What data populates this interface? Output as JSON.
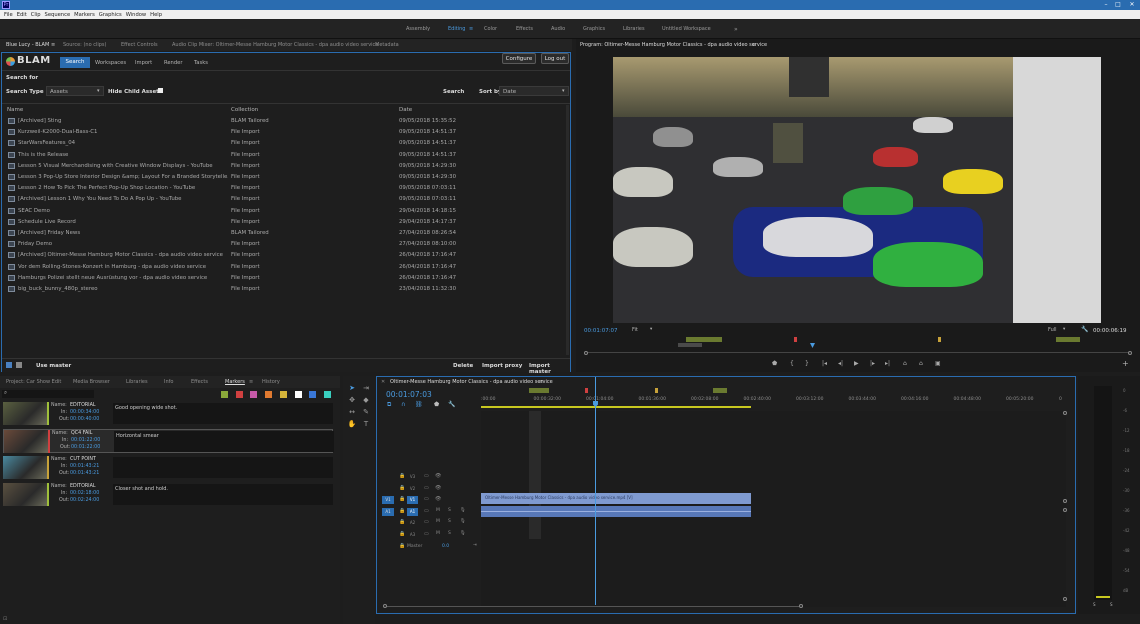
{
  "menu": [
    "File",
    "Edit",
    "Clip",
    "Sequence",
    "Markers",
    "Graphics",
    "Window",
    "Help"
  ],
  "workspaces": [
    "Assembly",
    "Editing",
    "Color",
    "Effects",
    "Audio",
    "Graphics",
    "Libraries",
    "Untitled Workspace"
  ],
  "left_tabs": [
    "Blue Lucy - BLAM",
    "Source: (no clips)",
    "Effect Controls",
    "Audio Clip Mixer: Oltimer-Messe Hamburg Motor Classics - dpa audio video service",
    "Metadata"
  ],
  "blam": {
    "logo": "BLAM",
    "tabs": [
      "Search",
      "Workspaces",
      "Import",
      "Render",
      "Tasks"
    ],
    "configure": "Configure",
    "logout": "Log out",
    "search_for": "Search for",
    "search_type_label": "Search Type",
    "search_type_value": "Assets",
    "hide_child_label": "Hide Child Assets",
    "search_btn": "Search",
    "sort_by_label": "Sort by",
    "sort_by_value": "Date",
    "col_name": "Name",
    "col_collection": "Collection",
    "col_date": "Date",
    "rows": [
      {
        "name": "[Archived] Sting",
        "collection": "BLAM Tailored",
        "date": "09/05/2018 15:35:52"
      },
      {
        "name": "Kurzweil-K2000-Dual-Bass-C1",
        "collection": "File Import",
        "date": "09/05/2018 14:51:37"
      },
      {
        "name": "StarWarsFeatures_04",
        "collection": "File Import",
        "date": "09/05/2018 14:51:37"
      },
      {
        "name": "This is the Release",
        "collection": "File Import",
        "date": "09/05/2018 14:51:37"
      },
      {
        "name": "Lesson 5 Visual Merchandising with Creative Window Displays - YouTube",
        "collection": "File Import",
        "date": "09/05/2018 14:29:30"
      },
      {
        "name": "Lesson 3 Pop-Up Store Interior Design &amp; Layout For a Branded Storytelle...",
        "collection": "File Import",
        "date": "09/05/2018 14:29:30"
      },
      {
        "name": "Lesson 2 How To Pick The Perfect Pop-Up Shop Location - YouTube",
        "collection": "File Import",
        "date": "09/05/2018 07:03:11"
      },
      {
        "name": "[Archived] Lesson 1 Why You Need To Do A Pop Up - YouTube",
        "collection": "File Import",
        "date": "09/05/2018 07:03:11"
      },
      {
        "name": "SEAC Demo",
        "collection": "File Import",
        "date": "29/04/2018 14:18:15"
      },
      {
        "name": "Schedule Live Record",
        "collection": "File Import",
        "date": "29/04/2018 14:17:37"
      },
      {
        "name": "[Archived] Friday News",
        "collection": "BLAM Tailored",
        "date": "27/04/2018 08:26:54"
      },
      {
        "name": "Friday Demo",
        "collection": "File Import",
        "date": "27/04/2018 08:10:00"
      },
      {
        "name": "[Archived] Oltimer-Messe Hamburg Motor Classics - dpa audio video service",
        "collection": "File Import",
        "date": "26/04/2018 17:16:47"
      },
      {
        "name": "Vor dem Rolling-Stones-Konzert in Hamburg - dpa audio video service",
        "collection": "File Import",
        "date": "26/04/2018 17:16:47"
      },
      {
        "name": "Hamburgs Polizei stellt neue Ausrüstung vor - dpa audio video service",
        "collection": "File Import",
        "date": "26/04/2018 17:16:47"
      },
      {
        "name": "big_buck_bunny_480p_stereo",
        "collection": "File Import",
        "date": "23/04/2018 11:32:30"
      }
    ],
    "use_master": "Use master",
    "delete": "Delete",
    "import_proxy": "Import proxy",
    "import_master": "Import master"
  },
  "program": {
    "title": "Program: Oltimer-Messe Hamburg Motor Classics - dpa audio video service",
    "timecode": "00:01:07:07",
    "fit": "Fit",
    "full": "Full",
    "duration": "00:00:06:19"
  },
  "bottom_tabs": [
    "Project: Car Show Edit",
    "Media Browser",
    "Libraries",
    "Info",
    "Effects",
    "Markers",
    "History"
  ],
  "markers": [
    {
      "name": "EDITORIAL",
      "in": "00:00:34:00",
      "out": "00:00:40:00",
      "comment": "Good opening wide shot.",
      "color": "#9fbf3b"
    },
    {
      "name": "QC4 FAIL",
      "in": "00:01:22:00",
      "out": "00:01:22:00",
      "comment": "Horizontal smear",
      "color": "#d04040"
    },
    {
      "name": "CUT POINT",
      "in": "00:01:43:21",
      "out": "00:01:43:21",
      "comment": "",
      "color": "#c7a23a"
    },
    {
      "name": "EDITORIAL",
      "in": "00:02:18:00",
      "out": "00:02:24:00",
      "comment": "Closer shot and hold.",
      "color": "#9fbf3b"
    }
  ],
  "marker_labels": {
    "name": "Name:",
    "in": "In:",
    "out": "Out:"
  },
  "marker_swatches": [
    "#8aa83a",
    "#d04040",
    "#c65aa8",
    "#e07a30",
    "#d6b53a",
    "#ffffff",
    "#3a78d8",
    "#3ad0c0"
  ],
  "timeline": {
    "title": "Oltimer-Messe Hamburg Motor Classics - dpa audio video service",
    "timecode": "00:01:07:03",
    "ruler": [
      ":00:00",
      "00:00:32:00",
      "00:01:04:00",
      "00:01:36:00",
      "00:02:08:00",
      "00:02:40:00",
      "00:03:12:00",
      "00:03:44:00",
      "00:04:16:00",
      "00:04:48:00",
      "00:05:20:00",
      "0"
    ],
    "tracks": [
      "V3",
      "V2",
      "V1",
      "A1",
      "A2",
      "A3"
    ],
    "master": "Master",
    "master_val": "0.0",
    "clip_label": "Oltimer-Messe Hamburg Motor Classics - dpa audio video service.mp4 [V]"
  },
  "meter_labels": [
    "0",
    "-6",
    "-12",
    "-18",
    "-24",
    "-30",
    "-36",
    "-42",
    "-48",
    "-54",
    "dB"
  ],
  "meter_bottom": [
    "S",
    "S"
  ]
}
